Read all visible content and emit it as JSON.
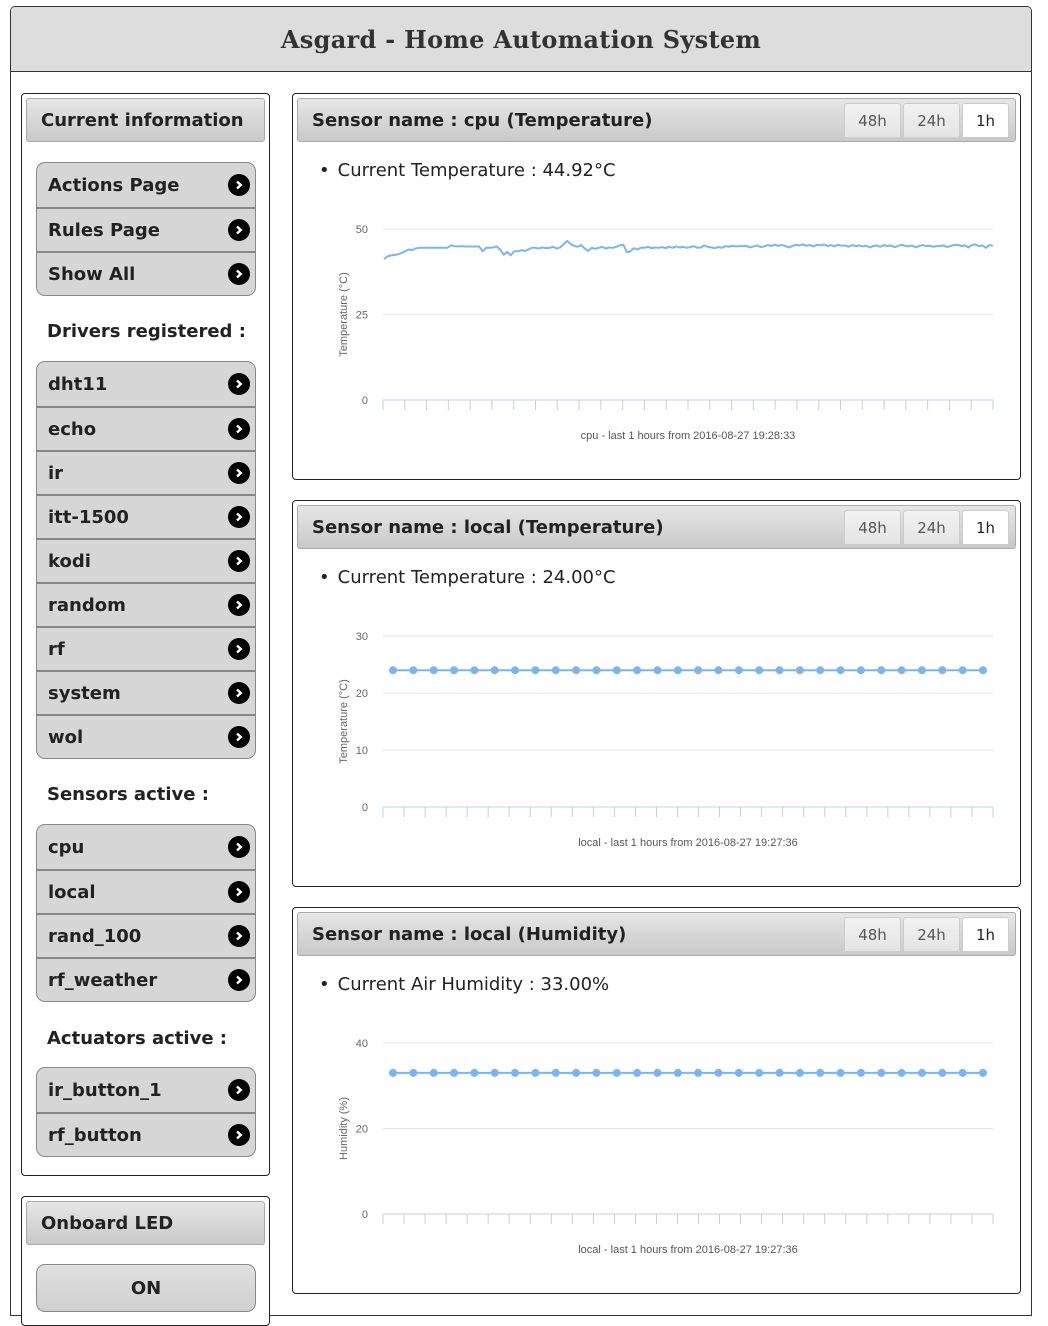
{
  "header": {
    "title": "Asgard - Home Automation System"
  },
  "sidebar": {
    "current_info": {
      "title": "Current information",
      "links": [
        "Actions Page",
        "Rules Page",
        "Show All"
      ]
    },
    "drivers": {
      "label": "Drivers registered :",
      "items": [
        "dht11",
        "echo",
        "ir",
        "itt-1500",
        "kodi",
        "random",
        "rf",
        "system",
        "wol"
      ]
    },
    "sensors": {
      "label": "Sensors active :",
      "items": [
        "cpu",
        "local",
        "rand_100",
        "rf_weather"
      ]
    },
    "actuators": {
      "label": "Actuators active :",
      "items": [
        "ir_button_1",
        "rf_button"
      ]
    },
    "onboard_led": {
      "title": "Onboard LED",
      "button_label": "ON"
    }
  },
  "range_tabs": [
    "48h",
    "24h",
    "1h"
  ],
  "active_tab": "1h",
  "cards": [
    {
      "title": "Sensor name : cpu (Temperature)",
      "current": "Current Temperature : 44.92°C"
    },
    {
      "title": "Sensor name : local (Temperature)",
      "current": "Current Temperature : 24.00°C"
    },
    {
      "title": "Sensor name : local (Humidity)",
      "current": "Current Air Humidity : 33.00%"
    }
  ],
  "chart_data": [
    {
      "type": "line",
      "title": "",
      "xlabel": "cpu - last 1 hours from 2016-08-27 19:28:33",
      "ylabel": "Temperature (°C)",
      "ylim": [
        0,
        50
      ],
      "yticks": [
        0,
        25,
        50
      ],
      "x_tick_count": 29,
      "color": "#7cb5ec",
      "markers": false,
      "series": [
        {
          "name": "cpu",
          "values": [
            41.2,
            42.0,
            42.3,
            42.4,
            42.6,
            43.0,
            43.5,
            44.0,
            43.8,
            44.3,
            44.5,
            44.5,
            44.5,
            44.5,
            44.5,
            44.5,
            44.5,
            44.5,
            44.5,
            45.2,
            45.0,
            44.9,
            45.0,
            44.9,
            44.9,
            44.9,
            44.9,
            44.9,
            43.5,
            44.5,
            44.5,
            44.6,
            44.9,
            44.0,
            42.5,
            43.3,
            42.3,
            43.5,
            43.5,
            43.8,
            43.6,
            44.0,
            44.5,
            44.5,
            44.3,
            44.6,
            44.4,
            44.5,
            44.8,
            44.3,
            44.6,
            45.5,
            46.5,
            45.6,
            45.1,
            44.8,
            45.3,
            44.3,
            43.6,
            44.5,
            44.2,
            44.5,
            44.8,
            44.3,
            44.6,
            44.5,
            44.8,
            45.2,
            45.4,
            43.2,
            43.5,
            44.4,
            44.0,
            44.5,
            44.5,
            44.8,
            44.4,
            44.6,
            44.5,
            44.7,
            44.4,
            44.8,
            44.5,
            44.9,
            44.6,
            44.8,
            44.5,
            44.7,
            45.0,
            44.5,
            44.6,
            45.2,
            44.8,
            44.6,
            44.4,
            44.7,
            44.5,
            45.0,
            44.8,
            45.1,
            44.9,
            45.0,
            45.0,
            45.0,
            44.6,
            44.9,
            45.2,
            44.7,
            44.9,
            45.3,
            45.0,
            45.4,
            45.1,
            45.3,
            45.0,
            44.6,
            45.0,
            45.4,
            45.2,
            45.5,
            45.1,
            45.3,
            44.9,
            45.4,
            45.2,
            45.5,
            45.0,
            45.3,
            44.9,
            45.4,
            45.1,
            45.2,
            44.8,
            45.3,
            45.0,
            45.2,
            44.9,
            45.1,
            44.6,
            45.0,
            45.2,
            44.8,
            45.3,
            45.0,
            45.2,
            44.7,
            45.0,
            45.4,
            45.1,
            44.9,
            45.2,
            44.6,
            45.0,
            45.3,
            45.0,
            45.1,
            44.8,
            45.0,
            45.0,
            45.2,
            44.7,
            45.1,
            45.3,
            45.4,
            45.0,
            45.2,
            44.6,
            45.3,
            45.5,
            45.0,
            45.2,
            44.5,
            45.3,
            45.1
          ]
        }
      ]
    },
    {
      "type": "line",
      "title": "",
      "xlabel": "local - last 1 hours from 2016-08-27 19:27:36",
      "ylabel": "Temperature (°C)",
      "ylim": [
        0,
        30
      ],
      "yticks": [
        0,
        10,
        20,
        30
      ],
      "x_tick_count": 30,
      "color": "#7cb5ec",
      "markers": true,
      "series": [
        {
          "name": "local",
          "values": [
            24,
            24,
            24,
            24,
            24,
            24,
            24,
            24,
            24,
            24,
            24,
            24,
            24,
            24,
            24,
            24,
            24,
            24,
            24,
            24,
            24,
            24,
            24,
            24,
            24,
            24,
            24,
            24,
            24,
            24
          ]
        }
      ]
    },
    {
      "type": "line",
      "title": "",
      "xlabel": "local - last 1 hours from 2016-08-27 19:27:36",
      "ylabel": "Humidity (%)",
      "ylim": [
        0,
        40
      ],
      "yticks": [
        0,
        20,
        40
      ],
      "x_tick_count": 30,
      "color": "#7cb5ec",
      "markers": true,
      "series": [
        {
          "name": "local",
          "values": [
            33,
            33,
            33,
            33,
            33,
            33,
            33,
            33,
            33,
            33,
            33,
            33,
            33,
            33,
            33,
            33,
            33,
            33,
            33,
            33,
            33,
            33,
            33,
            33,
            33,
            33,
            33,
            33,
            33,
            33
          ]
        }
      ]
    }
  ]
}
